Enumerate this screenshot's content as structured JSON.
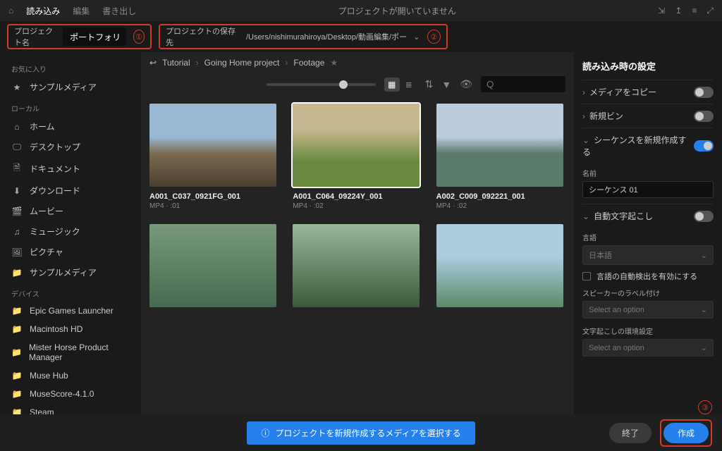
{
  "titlebar": {
    "home_icon": "⌂",
    "tabs": {
      "import": "読み込み",
      "edit": "編集",
      "export": "書き出し"
    },
    "center": "プロジェクトが開いていません",
    "icons": [
      "⇲",
      "↥",
      "≡",
      "⤢"
    ]
  },
  "topfields": {
    "project_name_label": "プロジェクト名",
    "project_name_value": "ポートフォリオ",
    "num1": "①",
    "save_location_label": "プロジェクトの保存先",
    "save_location_value": "/Users/nishimurahiroya/Desktop/動画編集/ポートフォリオ",
    "num2": "②"
  },
  "sidebar": {
    "favorites": "お気に入り",
    "sample_media": "サンプルメディア",
    "local": "ローカル",
    "items_local": [
      {
        "icon": "⌂",
        "label": "ホーム"
      },
      {
        "icon": "🖵",
        "label": "デスクトップ"
      },
      {
        "icon": "🗎",
        "label": "ドキュメント"
      },
      {
        "icon": "⬇",
        "label": "ダウンロード"
      },
      {
        "icon": "🎬",
        "label": "ムービー"
      },
      {
        "icon": "♫",
        "label": "ミュージック"
      },
      {
        "icon": "🖼",
        "label": "ピクチャ"
      },
      {
        "icon": "📁",
        "label": "サンプルメディア"
      }
    ],
    "devices": "デバイス",
    "items_dev": [
      {
        "icon": "📁",
        "label": "Epic Games Launcher"
      },
      {
        "icon": "📁",
        "label": "Macintosh HD"
      },
      {
        "icon": "📁",
        "label": "Mister Horse Product Manager"
      },
      {
        "icon": "📁",
        "label": "Muse Hub"
      },
      {
        "icon": "📁",
        "label": "MuseScore-4.1.0"
      },
      {
        "icon": "📁",
        "label": "Steam"
      }
    ]
  },
  "breadcrumb": {
    "back_icon": "↩",
    "items": [
      "Tutorial",
      "Going Home project",
      "Footage"
    ],
    "star": "★"
  },
  "toolbar": {
    "grid": "▦",
    "list": "≣",
    "sort": "⇅",
    "filter": "▼",
    "eye": "👁"
  },
  "search_placeholder": "Q",
  "clips": [
    {
      "name": "A001_C037_0921FG_001",
      "meta": "MP4 · :01",
      "cls": "t1",
      "sel": false
    },
    {
      "name": "A001_C064_09224Y_001",
      "meta": "MP4 · :02",
      "cls": "t2",
      "sel": true
    },
    {
      "name": "A002_C009_092221_001",
      "meta": "MP4 · :02",
      "cls": "t3",
      "sel": false
    },
    {
      "name": "",
      "meta": "",
      "cls": "t4",
      "sel": false
    },
    {
      "name": "",
      "meta": "",
      "cls": "t5",
      "sel": false
    },
    {
      "name": "",
      "meta": "",
      "cls": "t6",
      "sel": false
    }
  ],
  "rightpanel": {
    "title": "読み込み時の設定",
    "rows": {
      "copy_media": "メディアをコピー",
      "new_bin": "新規ビン",
      "create_seq": "シーケンスを新規作成する",
      "auto_trans": "自動文字起こし"
    },
    "name_label": "名前",
    "seq_name": "シーケンス 01",
    "lang_label": "言語",
    "lang_value": "日本語",
    "auto_detect": "言語の自動検出を有効にする",
    "speaker_label": "スピーカーのラベル付け",
    "select_option": "Select an option",
    "env_label": "文字起こしの環境設定"
  },
  "footer": {
    "banner_icon": "ⓘ",
    "banner": "プロジェクトを新規作成するメディアを選択する",
    "exit": "終了",
    "create": "作成",
    "num3": "③"
  }
}
